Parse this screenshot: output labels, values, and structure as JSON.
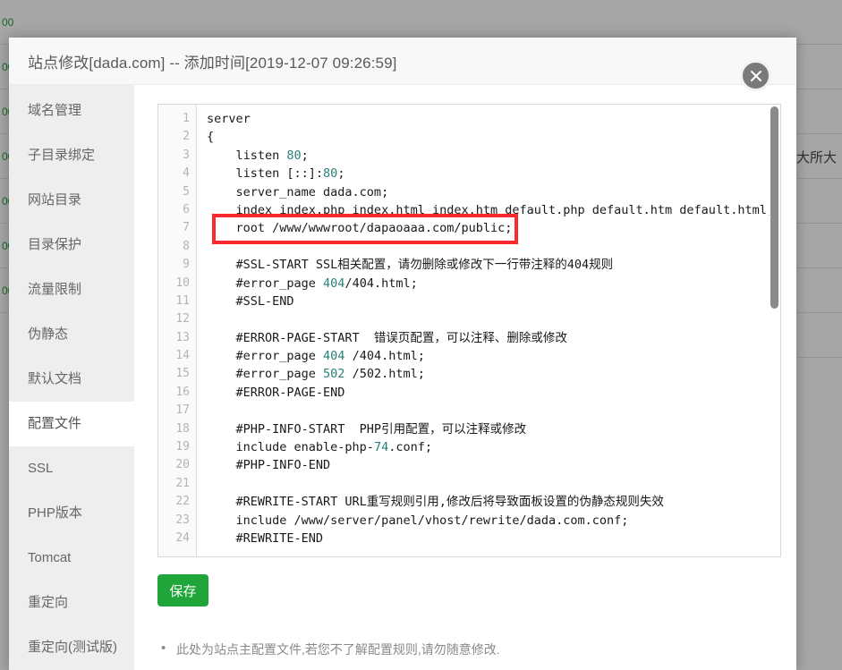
{
  "background": {
    "left_column_items": [
      "00",
      "00",
      "00",
      "00",
      "00",
      "00",
      "00"
    ],
    "rows": [
      {
        "text": ""
      },
      {
        "text": ""
      },
      {
        "text": ""
      },
      {
        "text": "大所大"
      },
      {
        "text": ""
      },
      {
        "text": ""
      },
      {
        "text": ""
      },
      {
        "text": ""
      }
    ]
  },
  "modal": {
    "title": "站点修改[dada.com] -- 添加时间[2019-12-07 09:26:59]",
    "close_icon": "close-icon",
    "sidebar": {
      "items": [
        {
          "label": "域名管理",
          "active": false
        },
        {
          "label": "子目录绑定",
          "active": false
        },
        {
          "label": "网站目录",
          "active": false
        },
        {
          "label": "目录保护",
          "active": false
        },
        {
          "label": "流量限制",
          "active": false
        },
        {
          "label": "伪静态",
          "active": false
        },
        {
          "label": "默认文档",
          "active": false
        },
        {
          "label": "配置文件",
          "active": true
        },
        {
          "label": "SSL",
          "active": false
        },
        {
          "label": "PHP版本",
          "active": false
        },
        {
          "label": "Tomcat",
          "active": false
        },
        {
          "label": "重定向",
          "active": false
        },
        {
          "label": "重定向(测试版)",
          "active": false
        }
      ]
    },
    "editor": {
      "lines": [
        {
          "n": 1,
          "segments": [
            {
              "t": "server"
            }
          ]
        },
        {
          "n": 2,
          "segments": [
            {
              "t": "{"
            }
          ]
        },
        {
          "n": 3,
          "segments": [
            {
              "t": "    listen "
            },
            {
              "t": "80",
              "c": "num"
            },
            {
              "t": ";"
            }
          ]
        },
        {
          "n": 4,
          "segments": [
            {
              "t": "    listen [::]:"
            },
            {
              "t": "80",
              "c": "num"
            },
            {
              "t": ";"
            }
          ]
        },
        {
          "n": 5,
          "segments": [
            {
              "t": "    server_name dada.com;"
            }
          ]
        },
        {
          "n": 6,
          "segments": [
            {
              "t": "    index index.php index.html index.htm default.php default.htm default.html;"
            }
          ]
        },
        {
          "n": 7,
          "segments": [
            {
              "t": "    root /www/wwwroot/dapaoaaa.com/public;"
            }
          ]
        },
        {
          "n": 8,
          "segments": [
            {
              "t": ""
            }
          ]
        },
        {
          "n": 9,
          "segments": [
            {
              "t": "    #SSL-START SSL相关配置，请勿删除或修改下一行带注释的404规则"
            }
          ]
        },
        {
          "n": 10,
          "segments": [
            {
              "t": "    #error_page "
            },
            {
              "t": "404",
              "c": "num"
            },
            {
              "t": "/404.html;"
            }
          ]
        },
        {
          "n": 11,
          "segments": [
            {
              "t": "    #SSL-END"
            }
          ]
        },
        {
          "n": 12,
          "segments": [
            {
              "t": ""
            }
          ]
        },
        {
          "n": 13,
          "segments": [
            {
              "t": "    #ERROR-PAGE-START  错误页配置，可以注释、删除或修改"
            }
          ]
        },
        {
          "n": 14,
          "segments": [
            {
              "t": "    #error_page "
            },
            {
              "t": "404",
              "c": "num"
            },
            {
              "t": " /404.html;"
            }
          ]
        },
        {
          "n": 15,
          "segments": [
            {
              "t": "    #error_page "
            },
            {
              "t": "502",
              "c": "num"
            },
            {
              "t": " /502.html;"
            }
          ]
        },
        {
          "n": 16,
          "segments": [
            {
              "t": "    #ERROR-PAGE-END"
            }
          ]
        },
        {
          "n": 17,
          "segments": [
            {
              "t": ""
            }
          ]
        },
        {
          "n": 18,
          "segments": [
            {
              "t": "    #PHP-INFO-START  PHP引用配置，可以注释或修改"
            }
          ]
        },
        {
          "n": 19,
          "segments": [
            {
              "t": "    include enable-php-"
            },
            {
              "t": "74",
              "c": "num"
            },
            {
              "t": ".conf;"
            }
          ]
        },
        {
          "n": 20,
          "segments": [
            {
              "t": "    #PHP-INFO-END"
            }
          ]
        },
        {
          "n": 21,
          "segments": [
            {
              "t": ""
            }
          ]
        },
        {
          "n": 22,
          "segments": [
            {
              "t": "    #REWRITE-START URL重写规则引用,修改后将导致面板设置的伪静态规则失效"
            }
          ]
        },
        {
          "n": 23,
          "segments": [
            {
              "t": "    include /www/server/panel/vhost/rewrite/dada.com.conf;"
            }
          ]
        },
        {
          "n": 24,
          "segments": [
            {
              "t": "    #REWRITE-END"
            }
          ]
        }
      ],
      "highlight_annotation": {
        "line": 7,
        "color": "#fc2a2a",
        "text": "root /www/wwwroot/dapaoaaa.com/public;"
      }
    },
    "save_button": {
      "label": "保存",
      "color": "#20a53a"
    },
    "notes": [
      "此处为站点主配置文件,若您不了解配置规则,请勿随意修改."
    ]
  }
}
